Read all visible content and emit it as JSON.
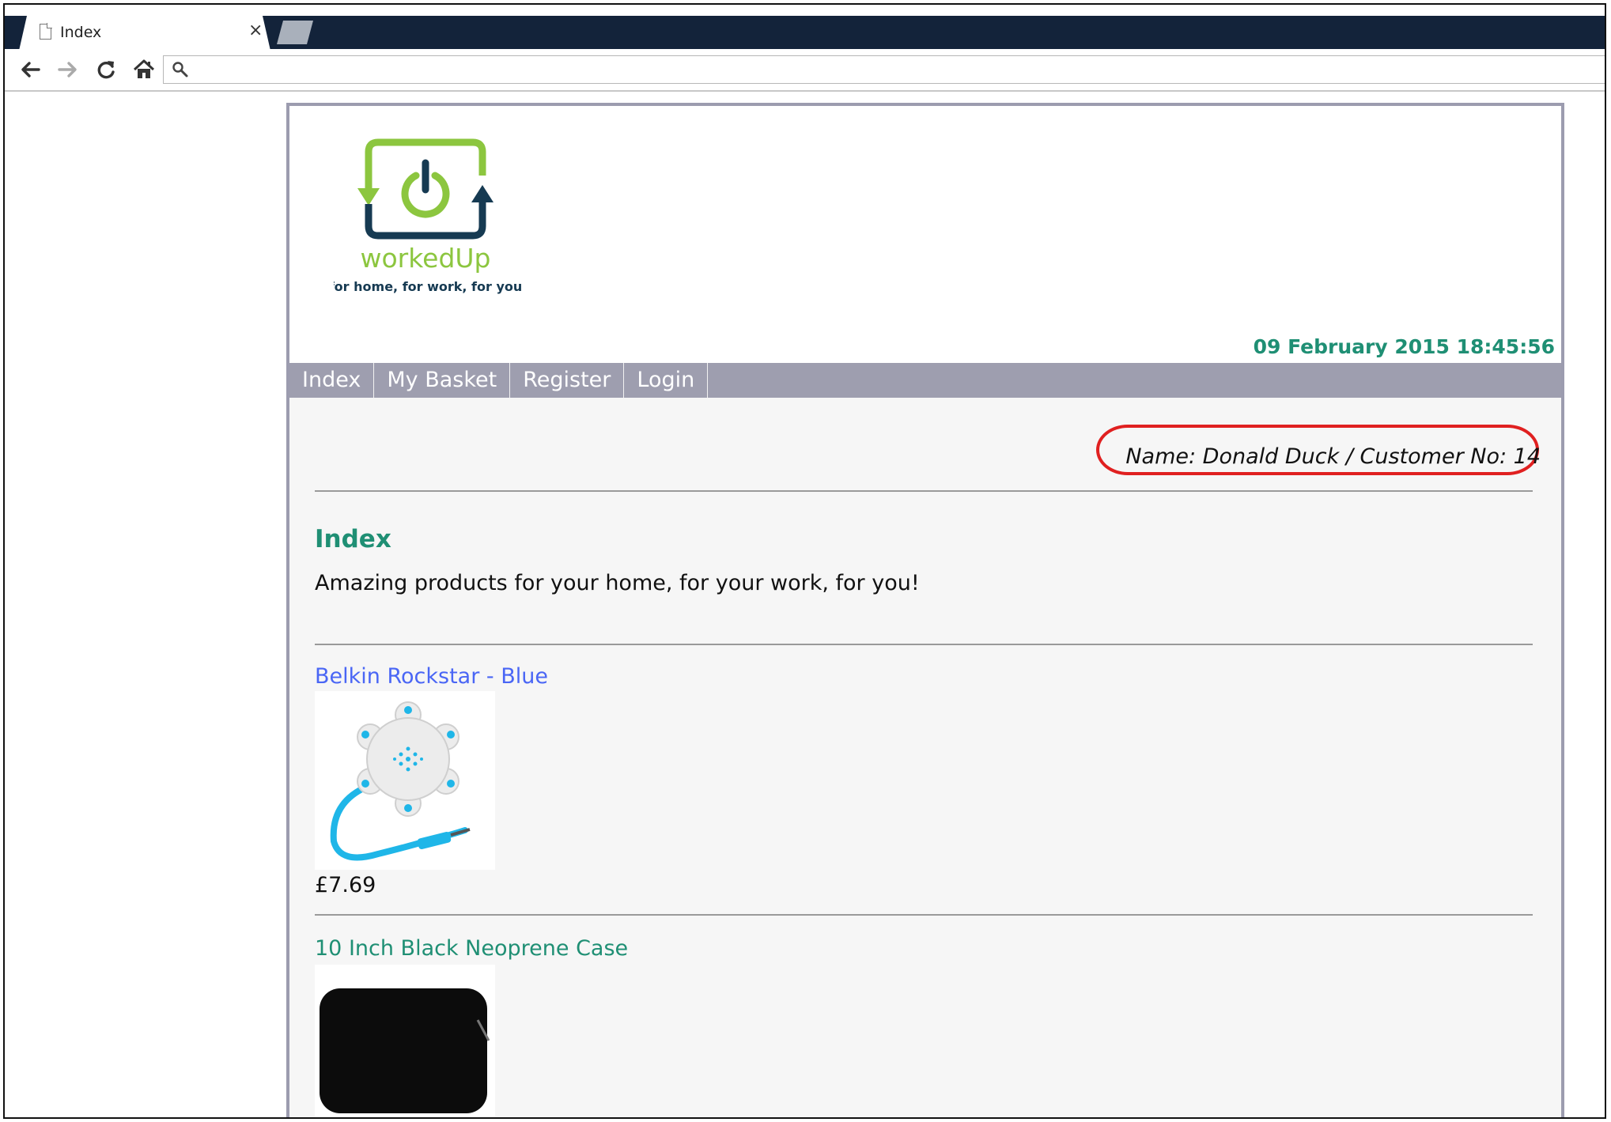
{
  "browser": {
    "tab_title": "Index",
    "close_glyph": "×",
    "address_value": "",
    "address_placeholder": ""
  },
  "site": {
    "brand": "workedUp",
    "tagline": "for home, for work, for you",
    "datetime": "09 February 2015 18:45:56",
    "colors": {
      "accent_teal": "#1f8f74",
      "nav_bg": "#9e9eaf",
      "link_blue": "#4a66f5",
      "logo_green": "#8cc63f",
      "logo_navy": "#163a52",
      "annotation_red": "#e02020"
    }
  },
  "nav": {
    "items": [
      {
        "label": "Index"
      },
      {
        "label": "My Basket"
      },
      {
        "label": "Register"
      },
      {
        "label": "Login"
      }
    ]
  },
  "user": {
    "line": "Name: Donald Duck / Customer No: 14"
  },
  "main": {
    "heading": "Index",
    "intro": "Amazing products for your home, for your work, for you!"
  },
  "products": [
    {
      "title": "Belkin Rockstar - Blue",
      "price": "£7.69",
      "image_icon": "audio-splitter-icon",
      "link_color": "#4a66f5"
    },
    {
      "title": "10 Inch Black Neoprene Case",
      "price": "",
      "image_icon": "laptop-sleeve-icon",
      "link_color": "#1f8f74"
    }
  ]
}
